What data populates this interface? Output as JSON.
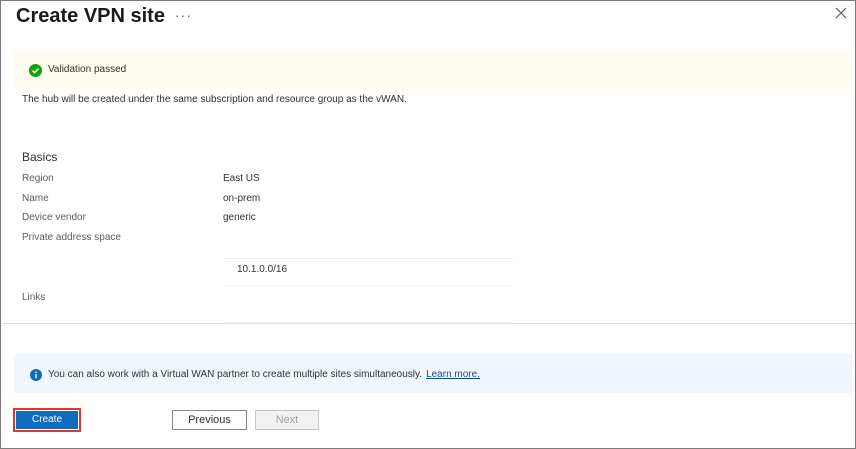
{
  "header": {
    "title": "Create VPN site",
    "more_label": "···"
  },
  "validation": {
    "text": "Validation passed",
    "status_color": "#13a10e"
  },
  "hub_note": "The hub will be created under the same subscription and resource group as the vWAN.",
  "basics": {
    "section_title": "Basics",
    "rows": [
      {
        "label": "Region",
        "value": "East US"
      },
      {
        "label": "Name",
        "value": "on-prem"
      },
      {
        "label": "Device vendor",
        "value": "generic"
      },
      {
        "label": "Private address space",
        "value": ""
      }
    ],
    "address_space_value": "10.1.0.0/16",
    "links_label": "Links"
  },
  "info": {
    "text": "You can also work with a Virtual WAN partner to create multiple sites simultaneously.",
    "link_text": "Learn more.",
    "icon_color": "#0f6cbd"
  },
  "footer": {
    "create_label": "Create",
    "previous_label": "Previous",
    "next_label": "Next"
  }
}
